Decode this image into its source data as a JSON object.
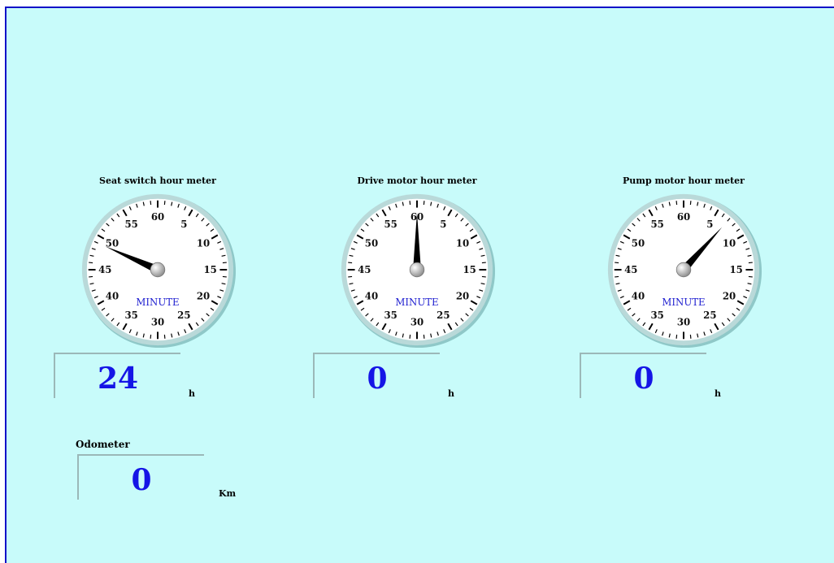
{
  "meters": [
    {
      "title": "Seat switch hour meter",
      "value": "24",
      "unit": "h",
      "dial_label": "MINUTE",
      "minute": 49
    },
    {
      "title": "Drive motor hour meter",
      "value": "0",
      "unit": "h",
      "dial_label": "MINUTE",
      "minute": 60
    },
    {
      "title": "Pump motor hour meter",
      "value": "0",
      "unit": "h",
      "dial_label": "MINUTE",
      "minute": 7
    }
  ],
  "dial_numbers": [
    "60",
    "5",
    "10",
    "15",
    "20",
    "25",
    "30",
    "35",
    "40",
    "45",
    "50",
    "55"
  ],
  "odometer": {
    "label": "Odometer",
    "value": "0",
    "unit": "Km"
  },
  "colors": {
    "background": "#c8fbfa",
    "frame_border": "#1212c8",
    "readout_text": "#1515e6",
    "dial_label_text": "#2020d0"
  }
}
